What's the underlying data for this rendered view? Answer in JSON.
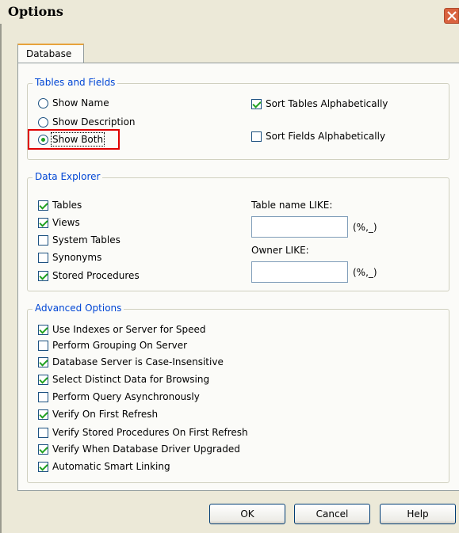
{
  "window": {
    "title": "Options"
  },
  "tabs": [
    {
      "label": "Database"
    }
  ],
  "tables_fields": {
    "legend": "Tables and Fields",
    "radios": [
      {
        "label": "Show Name",
        "selected": false
      },
      {
        "label": "Show Description",
        "selected": false
      },
      {
        "label": "Show Both",
        "selected": true
      }
    ],
    "checks": [
      {
        "label": "Sort Tables Alphabetically",
        "checked": true
      },
      {
        "label": "Sort Fields Alphabetically",
        "checked": false
      }
    ]
  },
  "data_explorer": {
    "legend": "Data Explorer",
    "checks": [
      {
        "label": "Tables",
        "checked": true
      },
      {
        "label": "Views",
        "checked": true
      },
      {
        "label": "System Tables",
        "checked": false
      },
      {
        "label": "Synonyms",
        "checked": false
      },
      {
        "label": "Stored Procedures",
        "checked": true
      }
    ],
    "table_like": {
      "label": "Table name LIKE:",
      "value": "",
      "hint": "(%,_)"
    },
    "owner_like": {
      "label": "Owner LIKE:",
      "value": "",
      "hint": "(%,_)"
    }
  },
  "advanced": {
    "legend": "Advanced Options",
    "checks": [
      {
        "label": "Use Indexes or Server for Speed",
        "checked": true
      },
      {
        "label": "Perform Grouping On Server",
        "checked": false
      },
      {
        "label": "Database Server is Case-Insensitive",
        "checked": true
      },
      {
        "label": "Select Distinct Data for Browsing",
        "checked": true
      },
      {
        "label": "Perform Query Asynchronously",
        "checked": false
      },
      {
        "label": "Verify On First Refresh",
        "checked": true
      },
      {
        "label": "Verify Stored Procedures On First Refresh",
        "checked": false
      },
      {
        "label": "Verify When Database Driver Upgraded",
        "checked": true
      },
      {
        "label": "Automatic Smart Linking",
        "checked": true
      }
    ]
  },
  "buttons": {
    "ok": "OK",
    "cancel": "Cancel",
    "help": "Help"
  },
  "icons": {
    "close": "close-icon"
  },
  "colors": {
    "legend": "#0046d5",
    "highlight": "#e00000",
    "check": "#21a121"
  }
}
